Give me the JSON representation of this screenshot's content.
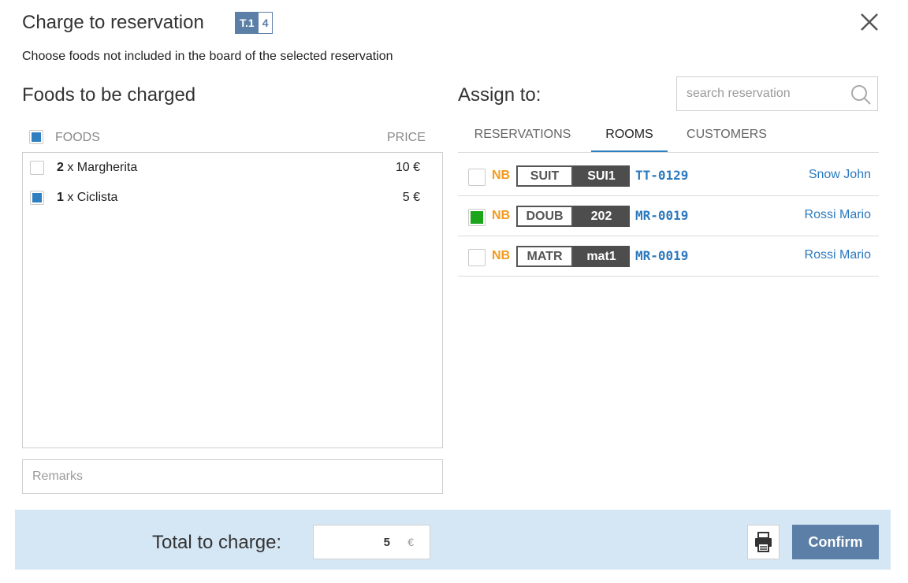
{
  "dialog": {
    "title": "Charge to reservation",
    "table_badge": {
      "prefix": "T.1",
      "number": "4"
    },
    "subtitle": "Choose foods not included in the board of the selected reservation"
  },
  "foods_panel": {
    "heading": "Foods to be charged",
    "col_foods": "FOODS",
    "col_price": "PRICE",
    "select_all_checked": true,
    "items": [
      {
        "qty": "2",
        "name": " x Margherita",
        "price": "10 €",
        "checked": false
      },
      {
        "qty": "1",
        "name": " x Ciclista",
        "price": "5 €",
        "checked": true
      }
    ],
    "remarks_placeholder": "Remarks"
  },
  "assign_panel": {
    "heading": "Assign to:",
    "search_placeholder": "search reservation",
    "tabs": [
      {
        "label": "RESERVATIONS",
        "active": false
      },
      {
        "label": "ROOMS",
        "active": true
      },
      {
        "label": "CUSTOMERS",
        "active": false
      }
    ],
    "rows": [
      {
        "board": "NB",
        "room_type": "SUIT",
        "room_code": "SUI1",
        "res_id": "TT-0129",
        "guest": "Snow John",
        "checked": false
      },
      {
        "board": "NB",
        "room_type": "DOUB",
        "room_code": "202",
        "res_id": "MR-0019",
        "guest": "Rossi Mario",
        "checked": true
      },
      {
        "board": "NB",
        "room_type": "MATR",
        "room_code": "mat1",
        "res_id": "MR-0019",
        "guest": "Rossi Mario",
        "checked": false
      }
    ]
  },
  "footer": {
    "total_label": "Total to charge:",
    "total_value": "5",
    "currency": "€",
    "print_icon": "printer-icon",
    "confirm_label": "Confirm"
  },
  "colors": {
    "accent": "#5b7fa6",
    "checkbox_blue": "#2f7fc1",
    "checkbox_green": "#1aa51a",
    "board_orange": "#f29a1e",
    "link_blue": "#2c79be",
    "footer_bg": "#d5e7f5"
  }
}
